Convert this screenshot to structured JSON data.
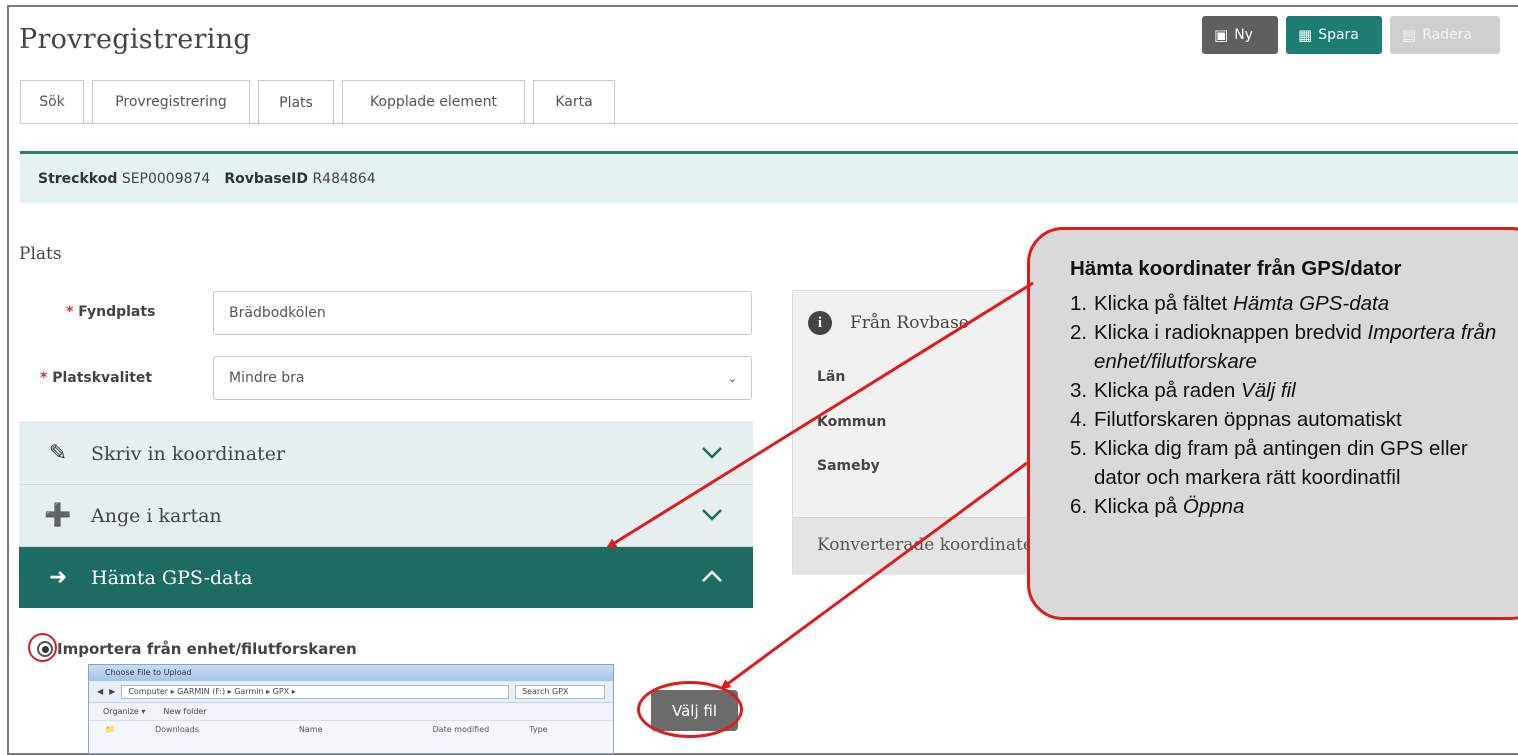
{
  "app": {
    "title": "Provregistrering"
  },
  "toolbar": {
    "new_label": "Ny",
    "save_label": "Spara",
    "delete_label": "Radera"
  },
  "tabs": [
    {
      "label": "Sök"
    },
    {
      "label": "Provregistrering"
    },
    {
      "label": "Plats"
    },
    {
      "label": "Kopplade element"
    },
    {
      "label": "Karta"
    }
  ],
  "active_tab": "Plats",
  "barcode": {
    "streckkod_label": "Streckkod",
    "streckkod_value": "SEP0009874",
    "rovbase_label": "RovbaseID",
    "rovbase_value": "R484864"
  },
  "plats": {
    "section_title": "Plats",
    "fyndplats_label": "Fyndplats",
    "fyndplats_value": "Brädbodkölen",
    "platskvalitet_label": "Platskvalitet",
    "platskvalitet_value": "Mindre bra",
    "required_mark": "*"
  },
  "accordions": {
    "skriv": "Skriv in koordinater",
    "ange": "Ange i kartan",
    "hamta": "Hämta GPS-data"
  },
  "rovbase": {
    "title": "Från Rovbase",
    "lan_label": "Län",
    "kommun_label": "Kommun",
    "sameby_label": "Sameby",
    "konverterade_label": "Konverterade koordinater"
  },
  "gps": {
    "import_label": "Importera från enhet/filutforskaren",
    "select_file_label": "Välj fil"
  },
  "file_dialog": {
    "title": "Choose File to Upload",
    "address": "Computer ▸ GARMIN (F:) ▸ Garmin ▸ GPX ▸",
    "search_placeholder": "Search GPX",
    "organize": "Organize ▾",
    "new_folder": "New folder",
    "col_name": "Name",
    "col_date": "Date modified",
    "col_type": "Type",
    "first_item": "Downloads"
  },
  "callout": {
    "title": "Hämta koordinater från GPS/dator",
    "steps": [
      {
        "num": "1.",
        "pre": "Klicka på fältet ",
        "em": "Hämta GPS-data"
      },
      {
        "num": "2.",
        "pre": "Klicka i radioknappen bredvid ",
        "em": "Importera från"
      },
      {
        "num": "",
        "pre": "",
        "em": "enhet/filutforskare"
      },
      {
        "num": "3.",
        "pre": "Klicka på raden ",
        "em": "Välj fil"
      },
      {
        "num": "4.",
        "pre": "Filutforskaren öppnas automatiskt",
        "em": ""
      },
      {
        "num": "5.",
        "pre": "Klicka dig fram på antingen din GPS eller",
        "em": ""
      },
      {
        "num": "",
        "pre": "dator och markera rätt koordinatfil",
        "em": ""
      },
      {
        "num": "6.",
        "pre": "Klicka på ",
        "em": "Öppna"
      }
    ]
  },
  "colors": {
    "accent_teal": "#1e7d72",
    "accordion_open": "#1d6b63",
    "annotation_red": "#e01c1c",
    "required_red": "#d9302c"
  },
  "icons": {
    "new": "new-document-icon",
    "save": "floppy-disk-icon",
    "delete": "trash-icon",
    "skriv": "pencil-icon",
    "ange": "map-marker-plus-icon",
    "hamta": "device-import-icon",
    "info": "info-icon"
  }
}
